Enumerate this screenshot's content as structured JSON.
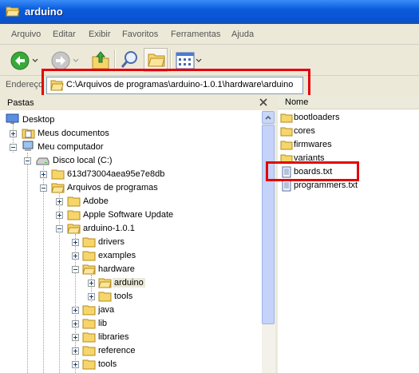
{
  "window": {
    "title": "arduino"
  },
  "menu": [
    "Arquivo",
    "Editar",
    "Exibir",
    "Favoritos",
    "Ferramentas",
    "Ajuda"
  ],
  "address": {
    "label": "Endereço",
    "value": "C:\\Arquivos de programas\\arduino-1.0.1\\hardware\\arduino"
  },
  "folders_pane": {
    "label": "Pastas"
  },
  "tree": [
    {
      "label": "Desktop",
      "icon": "desktop-icon"
    },
    {
      "label": "Meus documentos",
      "icon": "my-documents-icon"
    },
    {
      "label": "Meu computador",
      "icon": "my-computer-icon"
    },
    {
      "label": "Disco local (C:)",
      "icon": "drive-icon"
    },
    {
      "label": "613d73004aea95e7e8db",
      "icon": "folder-icon"
    },
    {
      "label": "Arquivos de programas",
      "icon": "folder-open-icon"
    },
    {
      "label": "Adobe",
      "icon": "folder-icon"
    },
    {
      "label": "Apple Software Update",
      "icon": "folder-icon"
    },
    {
      "label": "arduino-1.0.1",
      "icon": "folder-open-icon"
    },
    {
      "label": "drivers",
      "icon": "folder-icon"
    },
    {
      "label": "examples",
      "icon": "folder-icon"
    },
    {
      "label": "hardware",
      "icon": "folder-open-icon"
    },
    {
      "label": "arduino",
      "icon": "folder-open-icon",
      "selected": true
    },
    {
      "label": "tools",
      "icon": "folder-icon"
    },
    {
      "label": "java",
      "icon": "folder-icon"
    },
    {
      "label": "lib",
      "icon": "folder-icon"
    },
    {
      "label": "libraries",
      "icon": "folder-icon"
    },
    {
      "label": "reference",
      "icon": "folder-icon"
    },
    {
      "label": "tools",
      "icon": "folder-icon"
    }
  ],
  "list": {
    "column_name": "Nome",
    "items": [
      {
        "label": "bootloaders",
        "icon": "folder-icon"
      },
      {
        "label": "cores",
        "icon": "folder-icon"
      },
      {
        "label": "firmwares",
        "icon": "folder-icon"
      },
      {
        "label": "variants",
        "icon": "folder-icon"
      },
      {
        "label": "boards.txt",
        "icon": "text-file-icon"
      },
      {
        "label": "programmers.txt",
        "icon": "text-file-icon"
      }
    ]
  },
  "highlight_color": "#e3000b"
}
